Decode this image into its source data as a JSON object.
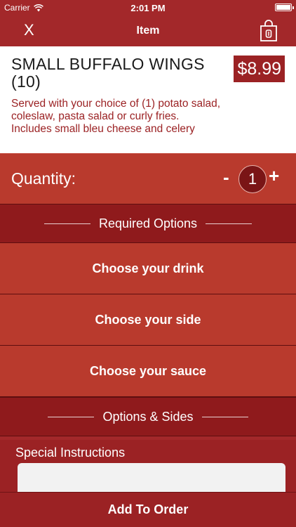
{
  "status_bar": {
    "carrier": "Carrier",
    "time": "2:01 PM"
  },
  "nav": {
    "close_label": "X",
    "title": "Item",
    "bag_icon": "shopping-bag-icon"
  },
  "item": {
    "name": "SMALL BUFFALO WINGS (10)",
    "price": "$8.99",
    "description": "Served with your choice of (1) potato salad, coleslaw, pasta salad or curly fries. Includes small bleu cheese and celery"
  },
  "quantity": {
    "label": "Quantity:",
    "minus": "-",
    "value": "1",
    "plus": "+"
  },
  "required_options": {
    "header": "Required Options",
    "items": [
      {
        "label": "Choose your drink"
      },
      {
        "label": "Choose your side"
      },
      {
        "label": "Choose your sauce"
      }
    ]
  },
  "options_sides": {
    "header": "Options & Sides"
  },
  "special_instructions": {
    "label": "Special Instructions",
    "value": ""
  },
  "add_button": {
    "label": "Add To Order"
  },
  "colors": {
    "brand": "#a3282a",
    "row": "#b93a2d",
    "header": "#8f1a1c"
  }
}
